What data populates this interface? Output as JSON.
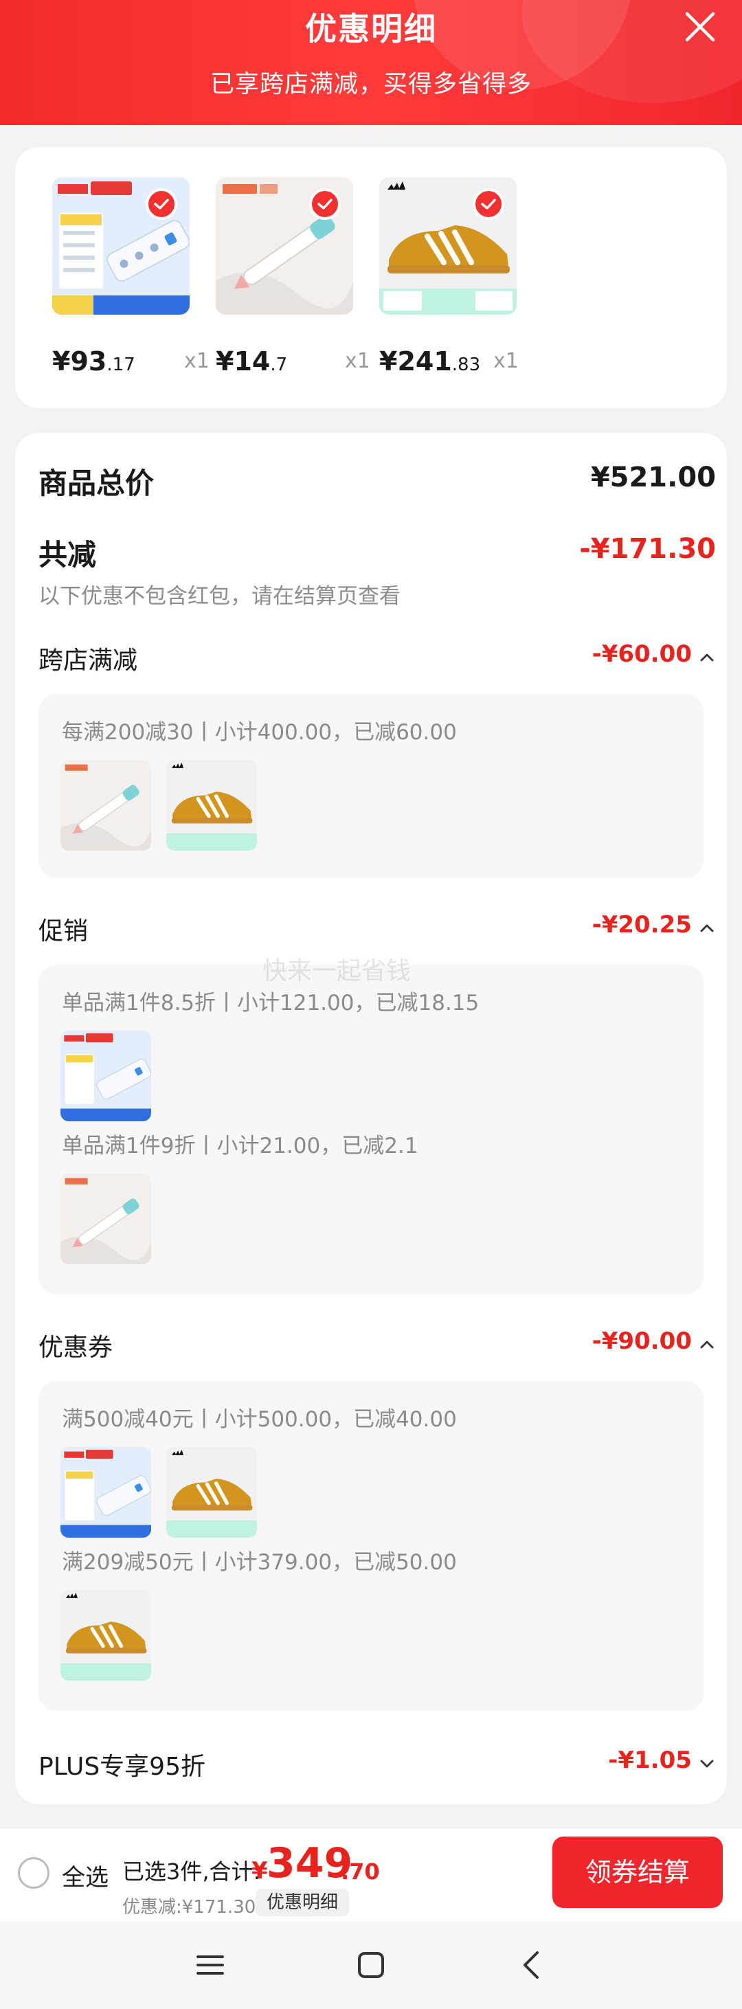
{
  "header": {
    "title": "优惠明细",
    "subtitle": "已享跨店满减，买得多省得多"
  },
  "products": [
    {
      "name_icon": "power-strip",
      "price_int": "¥93",
      "price_dec": ".17",
      "qty": "x1"
    },
    {
      "name_icon": "pen",
      "price_int": "¥14",
      "price_dec": ".7",
      "qty": "x1"
    },
    {
      "name_icon": "sneaker",
      "price_int": "¥241",
      "price_dec": ".83",
      "qty": "x1"
    }
  ],
  "summary": {
    "total_label": "商品总价",
    "total_value": "¥521.00",
    "reduce_label": "共减",
    "reduce_value": "-¥171.30",
    "reduce_note": "以下优惠不包含红包，请在结算页查看"
  },
  "sections": {
    "cross_store": {
      "label": "跨店满减",
      "value": "-¥60.00",
      "rules": [
        "每满200减30丨小计400.00，已减60.00"
      ]
    },
    "promotion": {
      "label": "促销",
      "value": "-¥20.25",
      "rules": [
        "单品满1件8.5折丨小计121.00，已减18.15",
        "单品满1件9折丨小计21.00，已减2.1"
      ]
    },
    "coupon": {
      "label": "优惠券",
      "value": "-¥90.00",
      "rules": [
        "满500减40元丨小计500.00，已减40.00",
        "满209减50元丨小计379.00，已减50.00"
      ]
    },
    "plus": {
      "label": "PLUS专享95折",
      "value": "-¥1.05"
    }
  },
  "watermark": "快来一起省钱",
  "footer": {
    "select_all": "全选",
    "selected_text": "已选3件,合计:",
    "total_symbol": "¥",
    "total_int": "349",
    "total_dec": ".70",
    "discount_text": "优惠减:¥171.30",
    "detail_button": "优惠明细",
    "checkout_button": "领券结算"
  },
  "colors": {
    "accent": "#f2242c",
    "discount_red": "#e8231d"
  }
}
